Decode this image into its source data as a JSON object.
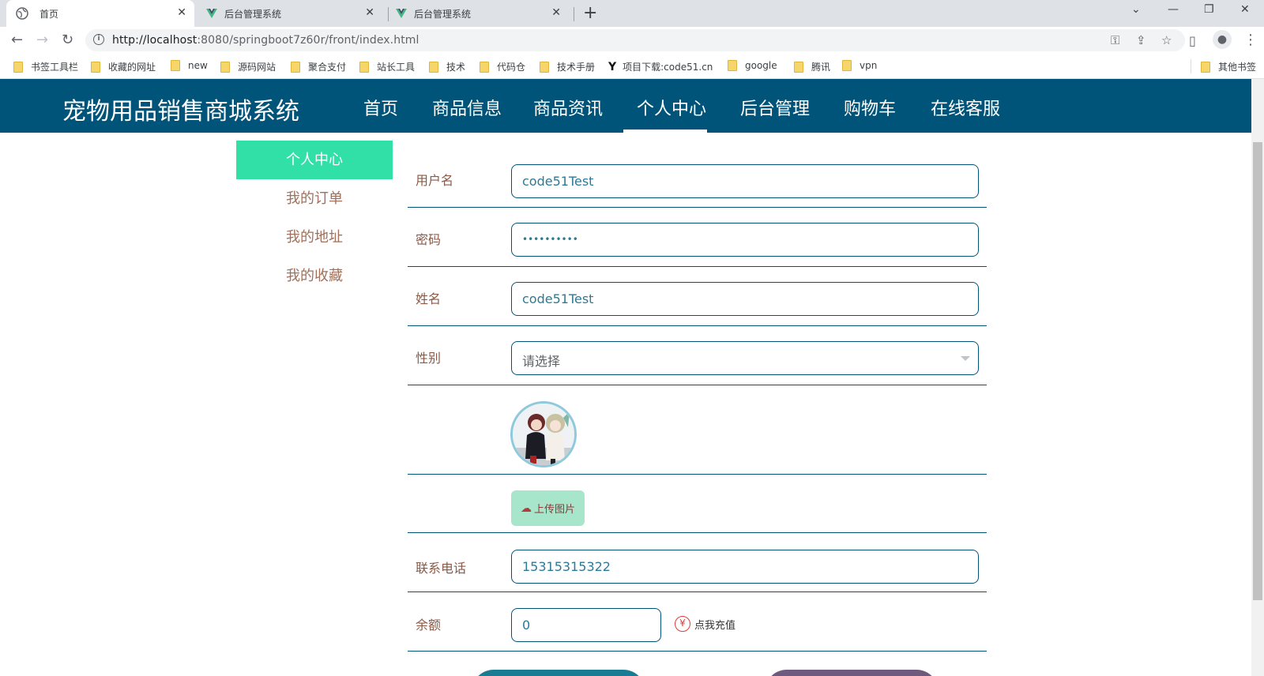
{
  "browser": {
    "tabs": [
      {
        "title": "首页",
        "active": true
      },
      {
        "title": "后台管理系统",
        "active": false
      },
      {
        "title": "后台管理系统",
        "active": false
      }
    ],
    "url_host": "http://localhost",
    "url_path": ":8080/springboot7z60r/front/index.html",
    "bookmarks": [
      "书签工具栏",
      "收藏的网址",
      "new",
      "源码网站",
      "聚合支付",
      "站长工具",
      "技术",
      "代码仓",
      "技术手册",
      "项目下载:code51.cn",
      "google",
      "腾讯",
      "vpn"
    ],
    "other_bookmarks": "其他书签"
  },
  "site": {
    "title": "宠物用品销售商城系统",
    "nav": [
      "首页",
      "商品信息",
      "商品资讯",
      "个人中心",
      "后台管理",
      "购物车",
      "在线客服"
    ],
    "active_nav": "个人中心"
  },
  "side_menu": {
    "items": [
      "个人中心",
      "我的订单",
      "我的地址",
      "我的收藏"
    ],
    "active": "个人中心"
  },
  "form": {
    "username_label": "用户名",
    "username_value": "code51Test",
    "password_label": "密码",
    "password_value": "••••••••••",
    "name_label": "姓名",
    "name_value": "code51Test",
    "gender_label": "性别",
    "gender_placeholder": "请选择",
    "upload_label": "上传图片",
    "phone_label": "联系电话",
    "phone_value": "15315315322",
    "balance_label": "余额",
    "balance_value": "0",
    "recharge_symbol": "¥",
    "recharge_label": "点我充值"
  },
  "colors": {
    "header_bg": "#005479",
    "side_active_bg": "#31e0a6",
    "label_color": "#8b5a47",
    "value_color": "#2b7a96",
    "upload_bg": "#a8e6cb"
  },
  "icons": {
    "tab_globe": "globe-icon",
    "tab_vue": "vue-logo-icon",
    "back": "back-arrow-icon",
    "forward": "forward-arrow-icon",
    "reload": "reload-icon",
    "key": "key-icon",
    "share": "share-icon",
    "star": "star-icon",
    "sidepanel": "side-panel-icon",
    "profile": "profile-icon",
    "menu": "kebab-menu-icon",
    "upload": "cloud-upload-icon",
    "yen": "yen-icon"
  }
}
